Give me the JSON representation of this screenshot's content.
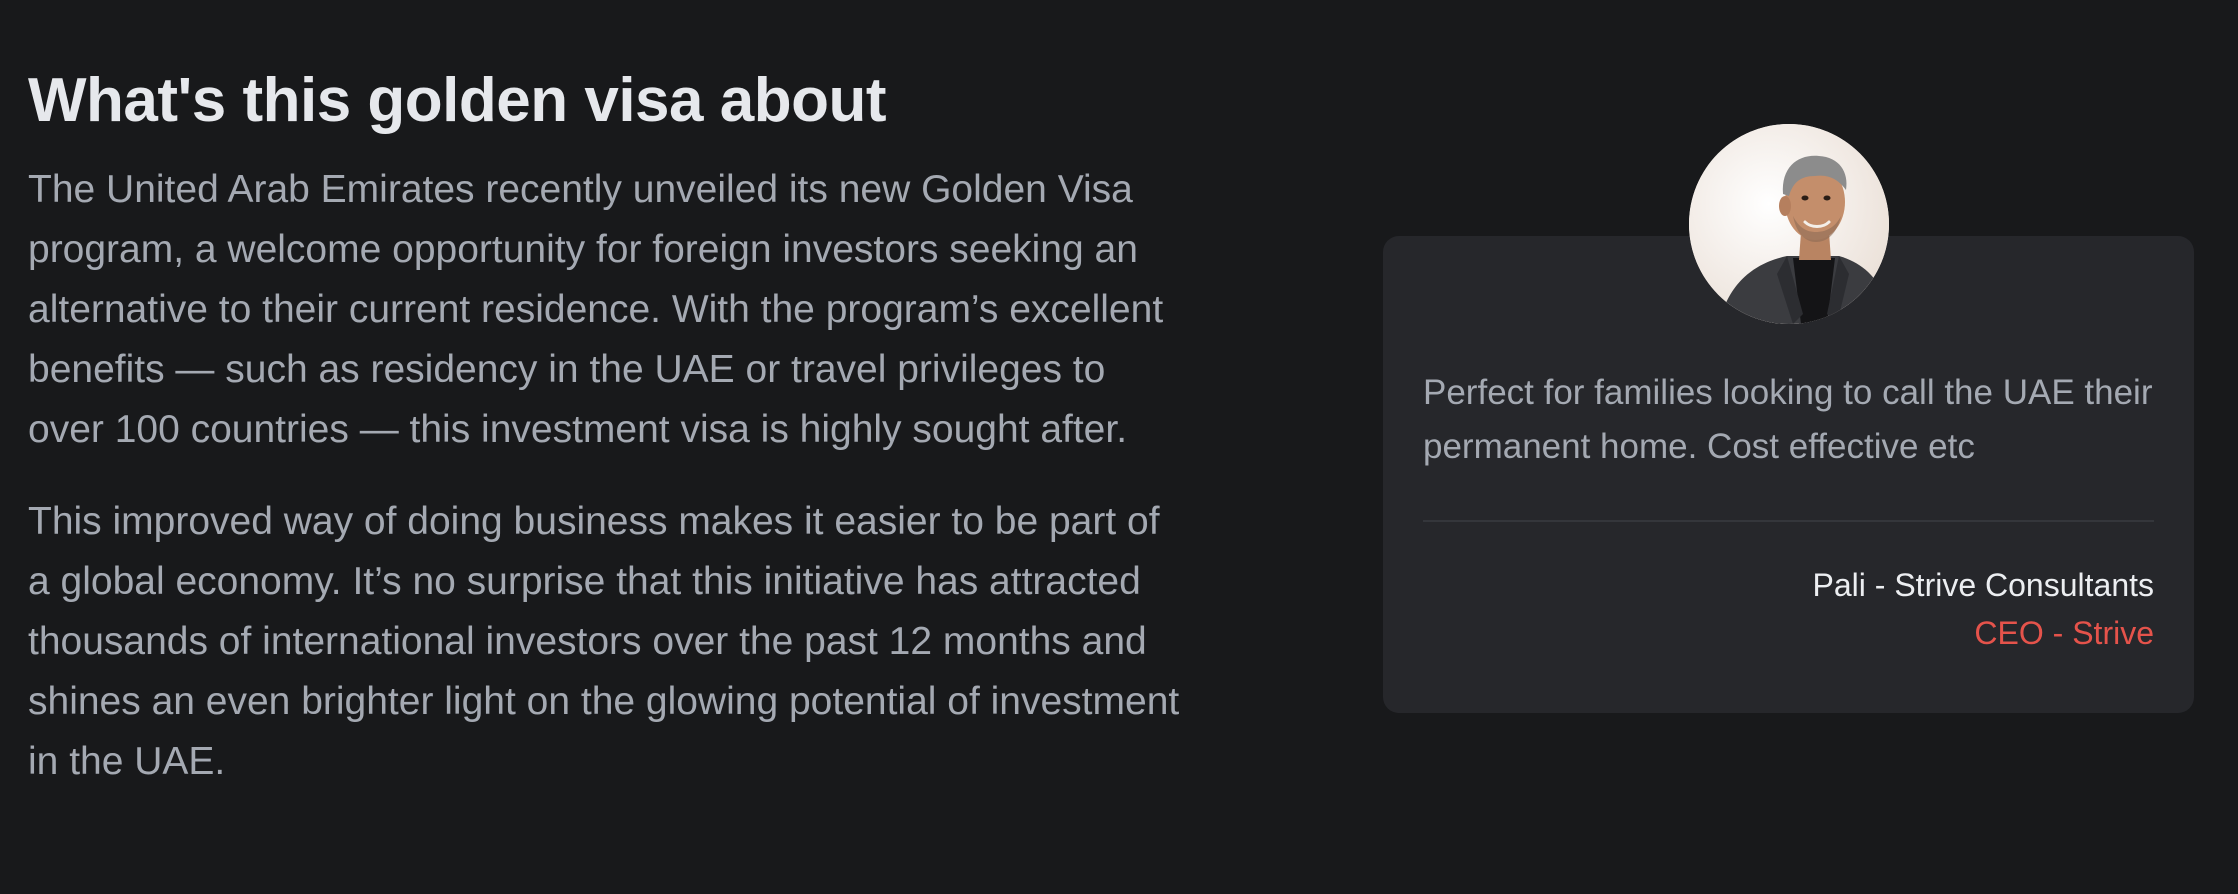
{
  "section": {
    "title": "What's this golden visa about",
    "paragraphs": [
      "The United Arab Emirates recently unveiled its new Golden Visa program, a welcome opportunity for foreign investors seeking an alternative to their current residence. With the program’s excellent benefits — such as residency in the UAE or travel privileges to over 100 countries — this investment visa is highly sought after.",
      "This improved way of doing business makes it easier to be part of a global economy. It’s no surprise that this initiative has attracted thousands of international investors over the past 12 months and shines an even brighter light on the glowing potential of investment in the UAE."
    ]
  },
  "testimonial": {
    "quote": "Perfect for families looking to call the UAE their permanent home. Cost effective etc",
    "author": "Pali - Strive Consultants",
    "role": "CEO - Strive",
    "avatar_icon": "person-portrait-icon"
  },
  "colors": {
    "background": "#18191b",
    "card": "#26272b",
    "heading": "#e6e8ec",
    "body_text": "#a4a9b2",
    "accent": "#e5534b"
  }
}
